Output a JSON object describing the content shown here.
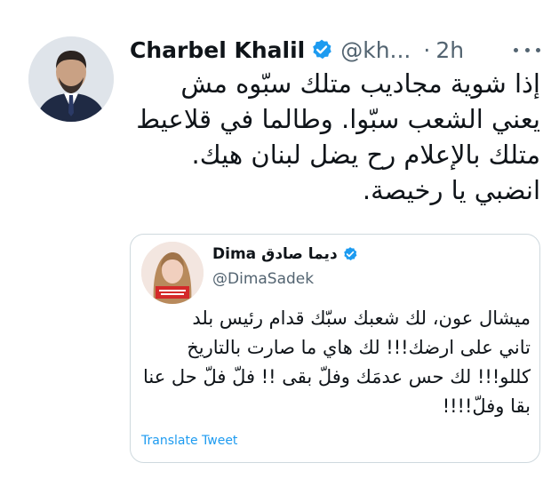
{
  "tweet": {
    "author_name": "Charbel Khalil",
    "handle": "@kh...",
    "separator": "·",
    "time": "2h",
    "lines": [
      "إذا شوية مجاديب متلك سبّوه مش",
      "يعني الشعب سبّوا. وطالما في قلاعيط",
      "متلك بالإعلام رح يضل لبنان هيك.",
      "انضبي يا رخيصة."
    ]
  },
  "quoted_tweet": {
    "author_name_en": "Dima",
    "author_name_ar": "ديما صادق",
    "handle": "@DimaSadek",
    "lines": [
      "ميشال عون، لك شعبك سبّك قدام رئيس بلد",
      "تاني على ارضك!!! لك هاي ما صارت بالتاريخ",
      "كللو!!! لك حس عدمَك وفلّ بقى !! فلّ فلّ حل عنا",
      "بقا وفلّ!!!!"
    ],
    "translate_label": "Translate Tweet"
  },
  "colors": {
    "text": "#0f1419",
    "secondary": "#536471",
    "accent": "#1d9bf0",
    "border": "#cfd9de"
  },
  "icons": {
    "verified": "verified-badge-icon",
    "more": "more-horizontal-icon"
  }
}
